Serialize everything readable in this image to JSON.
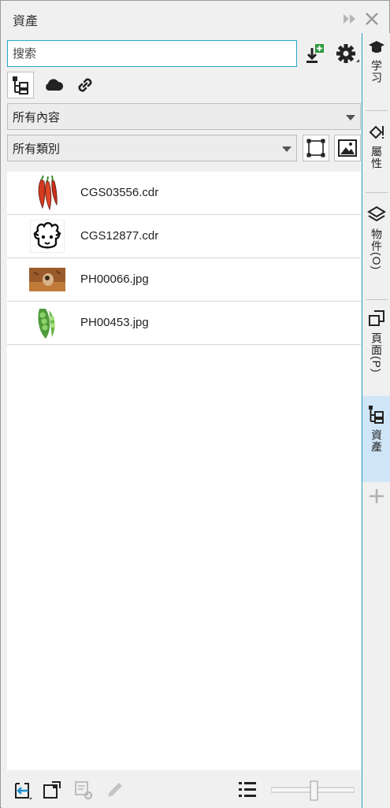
{
  "window": {
    "title": "資產"
  },
  "search": {
    "placeholder": "搜索",
    "value": ""
  },
  "filters": {
    "content": "所有內容",
    "category": "所有類別"
  },
  "assets": [
    {
      "name": "CGS03556.cdr",
      "thumb": "chili-peppers"
    },
    {
      "name": "CGS12877.cdr",
      "thumb": "sheep-face"
    },
    {
      "name": "PH00066.jpg",
      "thumb": "dog-photo"
    },
    {
      "name": "PH00453.jpg",
      "thumb": "green-peas"
    }
  ],
  "docker_tabs": [
    {
      "label": "学习",
      "icon": "graduation-cap-icon"
    },
    {
      "label": "屬性",
      "icon": "fill-bucket-icon"
    },
    {
      "label": "物件(O)",
      "icon": "layers-icon"
    },
    {
      "label": "頁面(P)",
      "icon": "pages-icon"
    },
    {
      "label": "資產",
      "icon": "assets-icon",
      "active": true
    }
  ],
  "colors": {
    "accent": "#2aa6c8",
    "active_tab": "#cfe6f8",
    "import_badge": "#2e9a3b"
  }
}
